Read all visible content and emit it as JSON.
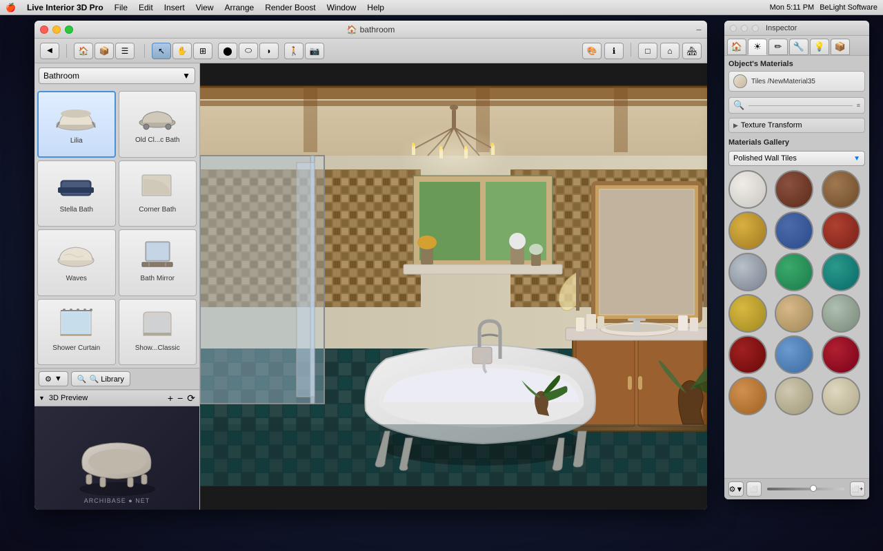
{
  "menubar": {
    "apple": "🍎",
    "app_name": "Live Interior 3D Pro",
    "menus": [
      "File",
      "Edit",
      "Insert",
      "View",
      "Arrange",
      "Render Boost",
      "Window",
      "Help"
    ],
    "time": "Mon 5:11 PM",
    "company": "BeLight Software"
  },
  "window": {
    "title": "bathroom",
    "title_icon": "🏠"
  },
  "left_panel": {
    "category": "Bathroom",
    "items": [
      {
        "id": "lilia",
        "label": "Lilia",
        "selected": true
      },
      {
        "id": "old-bath",
        "label": "Old Cl...c Bath",
        "selected": false
      },
      {
        "id": "stella-bath",
        "label": "Stella Bath",
        "selected": false
      },
      {
        "id": "corner-bath",
        "label": "Corner Bath",
        "selected": false
      },
      {
        "id": "waves",
        "label": "Waves",
        "selected": false
      },
      {
        "id": "bath-mirror",
        "label": "Bath Mirror",
        "selected": false
      },
      {
        "id": "shower-curtain",
        "label": "Shower Curtain",
        "selected": false
      },
      {
        "id": "show-classic",
        "label": "Show...Classic",
        "selected": false
      }
    ],
    "bottom_buttons": [
      {
        "id": "settings",
        "label": "⚙"
      },
      {
        "id": "search",
        "label": "🔍 Library"
      }
    ]
  },
  "preview": {
    "title": "3D Preview",
    "zoom_in": "+",
    "zoom_out": "−",
    "reset": "⟳"
  },
  "inspector": {
    "title": "Inspector",
    "tabs": [
      "🏠",
      "☀",
      "✏",
      "🔧",
      "💡",
      "📦"
    ],
    "objects_materials_title": "Object's Materials",
    "current_material": "Tiles /NewMaterial35",
    "texture_transform_label": "Texture Transform",
    "materials_gallery_title": "Materials Gallery",
    "gallery_dropdown": "Polished Wall Tiles",
    "swatches": [
      {
        "id": "s1",
        "colors": [
          "#e0ddd8",
          "#c8c5c0"
        ]
      },
      {
        "id": "s2",
        "colors": [
          "#6b3a2a",
          "#8b4a3a"
        ]
      },
      {
        "id": "s3",
        "colors": [
          "#8b6a4a",
          "#6b4a2a"
        ]
      },
      {
        "id": "s4",
        "colors": [
          "#c8a030",
          "#d8b040"
        ]
      },
      {
        "id": "s5",
        "colors": [
          "#2a4a8a",
          "#3a5a9a"
        ]
      },
      {
        "id": "s6",
        "colors": [
          "#9a3a2a",
          "#8a2a1a"
        ]
      },
      {
        "id": "s7",
        "colors": [
          "#a8b0b8",
          "#888f98"
        ]
      },
      {
        "id": "s8",
        "colors": [
          "#2a8a5a",
          "#1a7a4a"
        ]
      },
      {
        "id": "s9",
        "colors": [
          "#1a7a7a",
          "#0a6a6a"
        ]
      },
      {
        "id": "s10",
        "colors": [
          "#c8a030",
          "#d8b040"
        ]
      },
      {
        "id": "s11",
        "colors": [
          "#d8a878",
          "#c89868"
        ]
      },
      {
        "id": "s12",
        "colors": [
          "#a8b8a8",
          "#889898"
        ]
      },
      {
        "id": "s13",
        "colors": [
          "#8a1a1a",
          "#7a0a0a"
        ]
      },
      {
        "id": "s14",
        "colors": [
          "#5a8ab8",
          "#4a7aa8"
        ]
      },
      {
        "id": "s15",
        "colors": [
          "#9a1a2a",
          "#8a0a1a"
        ]
      },
      {
        "id": "s16",
        "colors": [
          "#c88040",
          "#b87030"
        ]
      },
      {
        "id": "s17",
        "colors": [
          "#c8c0a8",
          "#b8b098"
        ]
      },
      {
        "id": "s18",
        "colors": [
          "#d8d0b8",
          "#c8c0a8"
        ]
      }
    ]
  },
  "watermark": "ARCHIBASE ● NET"
}
